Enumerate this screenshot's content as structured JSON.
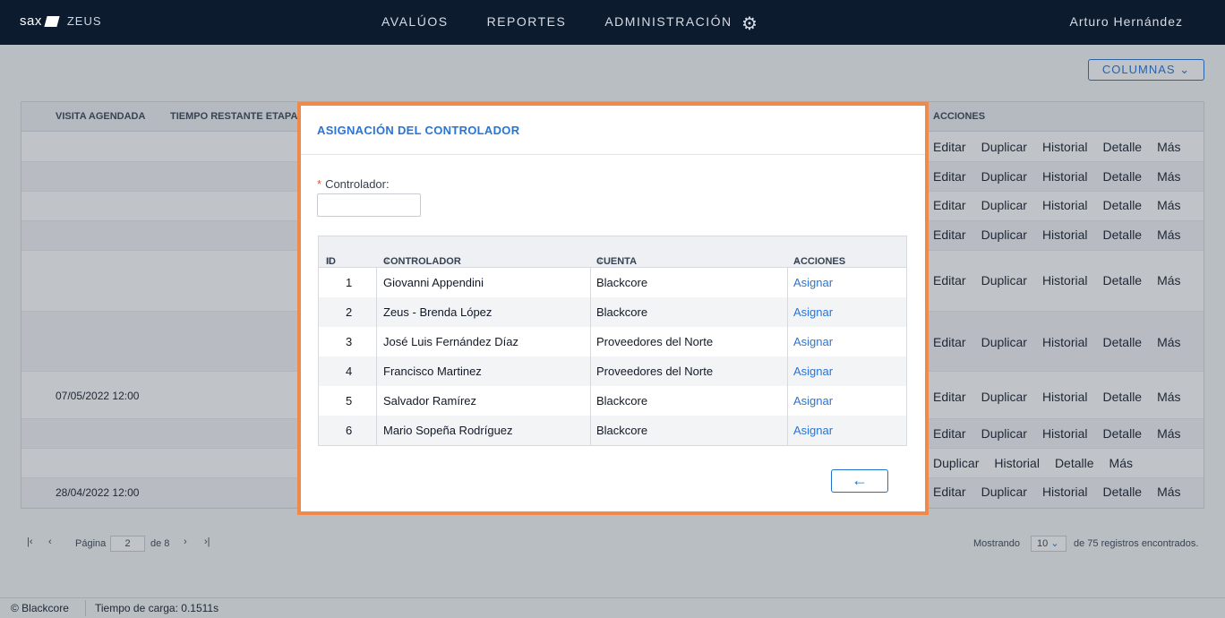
{
  "topbar": {
    "brand": "sax",
    "product": "ZEUS",
    "nav": [
      "AVALÚOS",
      "REPORTES",
      "ADMINISTRACIÓN"
    ],
    "settings_icon": "gear-icon",
    "user": "Arturo Hernández"
  },
  "toolbar": {
    "columns_label": "COLUMNAS"
  },
  "bg_table": {
    "headers": {
      "visita": "VISITA AGENDADA",
      "tiempo": "TIEMPO RESTANTE ETAPA",
      "acciones": "ACCIONES"
    },
    "actions": [
      "Editar",
      "Duplicar",
      "Historial",
      "Detalle",
      "Más"
    ],
    "actions_short": [
      "Duplicar",
      "Historial",
      "Detalle",
      "Más"
    ],
    "date1": "07/05/2022 12:00",
    "date2": "28/04/2022 12:00"
  },
  "pager": {
    "page_label": "Página",
    "page_value": "2",
    "of_label": "de 8",
    "showing_label": "Mostrando",
    "page_size": "10",
    "total_label": "de 75 registros encontrados."
  },
  "footer": {
    "copyright": "© Blackcore",
    "load_time": "Tiempo de carga: 0.1511s"
  },
  "modal": {
    "title": "ASIGNACIÓN DEL CONTROLADOR",
    "field_label": "Controlador:",
    "field_value": "",
    "headers": {
      "id": "ID",
      "controlador": "CONTROLADOR",
      "cuenta": "CUENTA",
      "acciones": "ACCIONES"
    },
    "rows": [
      {
        "id": "1",
        "name": "Giovanni Appendini",
        "cuenta": "Blackcore",
        "action": "Asignar"
      },
      {
        "id": "2",
        "name": "Zeus - Brenda López",
        "cuenta": "Blackcore",
        "action": "Asignar"
      },
      {
        "id": "3",
        "name": "José Luis Fernández Díaz",
        "cuenta": "Proveedores del Norte",
        "action": "Asignar"
      },
      {
        "id": "4",
        "name": "Francisco Martinez",
        "cuenta": "Proveedores del Norte",
        "action": "Asignar"
      },
      {
        "id": "5",
        "name": "Salvador Ramírez",
        "cuenta": "Blackcore",
        "action": "Asignar"
      },
      {
        "id": "6",
        "name": "Mario Sopeña Rodríguez",
        "cuenta": "Blackcore",
        "action": "Asignar"
      }
    ],
    "back_icon": "arrow-left-icon"
  },
  "colors": {
    "accent": "#2a74d6",
    "modal_border": "#f08a4b",
    "topbar": "#0d1b2e"
  }
}
